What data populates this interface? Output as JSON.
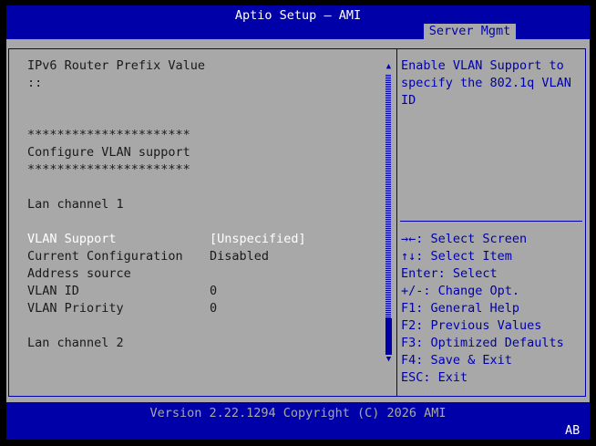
{
  "header": {
    "title": "Aptio Setup – AMI",
    "active_tab": "Server Mgmt"
  },
  "settings": {
    "ipv6_router_prefix_label": "IPv6 Router Prefix Value",
    "ipv6_router_prefix_value": "::",
    "separator_top": "**********************",
    "vlan_heading": "Configure VLAN support",
    "separator_bottom": "**********************",
    "lan_channel_1": "Lan channel 1",
    "vlan_support_label": "VLAN Support",
    "vlan_support_value": "[Unspecified]",
    "current_config_label": "Current Configuration",
    "current_config_value": "Disabled",
    "address_source_label": "Address source",
    "vlan_id_label": "VLAN ID",
    "vlan_id_value": "0",
    "vlan_priority_label": "VLAN Priority",
    "vlan_priority_value": "0",
    "lan_channel_2": "Lan channel 2"
  },
  "help": {
    "lines": [
      "Enable VLAN Support to",
      "specify the 802.1q VLAN",
      "ID"
    ]
  },
  "keys": [
    "→←: Select Screen",
    "↑↓: Select Item",
    "Enter: Select",
    "+/-: Change Opt.",
    "F1: General Help",
    "F2: Previous Values",
    "F3: Optimized Defaults",
    "F4: Save & Exit",
    "ESC: Exit"
  ],
  "scrollbar": {
    "up_glyph": "▲",
    "down_glyph": "▼"
  },
  "footer": {
    "version": "Version 2.22.1294 Copyright (C) 2026 AMI",
    "badge": "AB"
  },
  "colors": {
    "bios_blue": "#0000A8",
    "bios_gray": "#A8A8A8",
    "selected_text": "#FFFFFF"
  }
}
